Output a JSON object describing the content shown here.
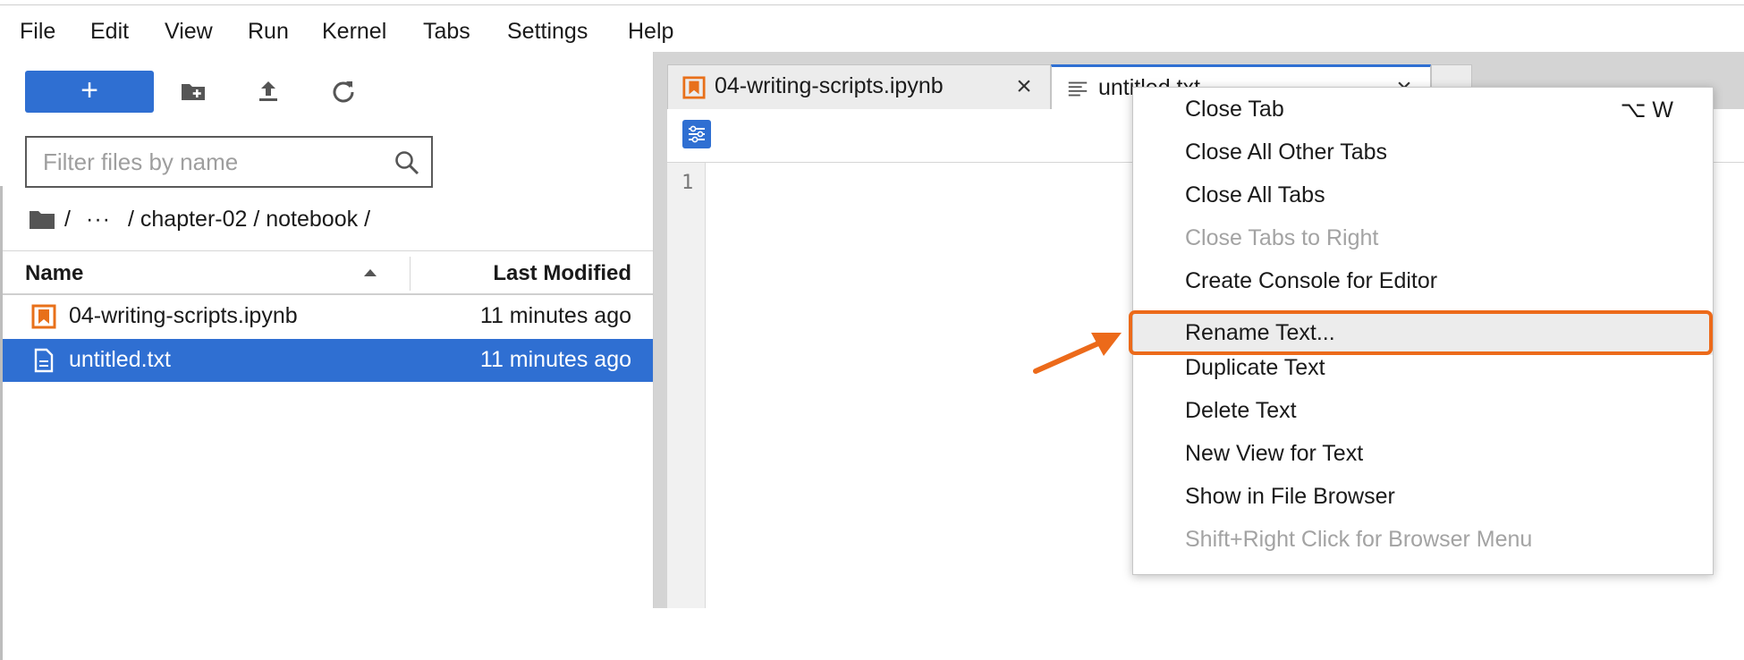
{
  "menubar": {
    "items": [
      "File",
      "Edit",
      "View",
      "Run",
      "Kernel",
      "Tabs",
      "Settings",
      "Help"
    ]
  },
  "file_browser": {
    "new_button_label": "+",
    "filter_placeholder": "Filter files by name",
    "breadcrumb": {
      "separator": "/",
      "ellipsis": "···",
      "path": "/ chapter-02 / notebook /"
    },
    "columns": {
      "name": "Name",
      "modified": "Last Modified"
    },
    "files": [
      {
        "name": "04-writing-scripts.ipynb",
        "modified": "11 minutes ago",
        "type": "notebook",
        "selected": false
      },
      {
        "name": "untitled.txt",
        "modified": "11 minutes ago",
        "type": "text",
        "selected": true
      }
    ]
  },
  "tabs": [
    {
      "label": "04-writing-scripts.ipynb",
      "icon": "notebook-icon",
      "active": false
    },
    {
      "label": "untitled.txt",
      "icon": "text-file-icon",
      "active": true
    }
  ],
  "editor": {
    "line_number": "1"
  },
  "context_menu": {
    "items": [
      {
        "label": "Close Tab",
        "shortcut": "⌥ W",
        "disabled": false
      },
      {
        "label": "Close All Other Tabs",
        "disabled": false
      },
      {
        "label": "Close All Tabs",
        "disabled": false
      },
      {
        "label": "Close Tabs to Right",
        "disabled": true
      },
      {
        "label": "Create Console for Editor",
        "disabled": false
      },
      {
        "label": "Rename Text...",
        "disabled": false,
        "highlighted": true
      },
      {
        "label": "Duplicate Text",
        "disabled": false
      },
      {
        "label": "Delete Text",
        "disabled": false
      },
      {
        "label": "New View for Text",
        "disabled": false
      },
      {
        "label": "Show in File Browser",
        "disabled": false
      },
      {
        "label": "Shift+Right Click for Browser Menu",
        "disabled": true
      }
    ]
  },
  "colors": {
    "accent": "#2f6fd2",
    "annotation": "#ec6a1a",
    "notebook_icon": "#e8701a"
  }
}
